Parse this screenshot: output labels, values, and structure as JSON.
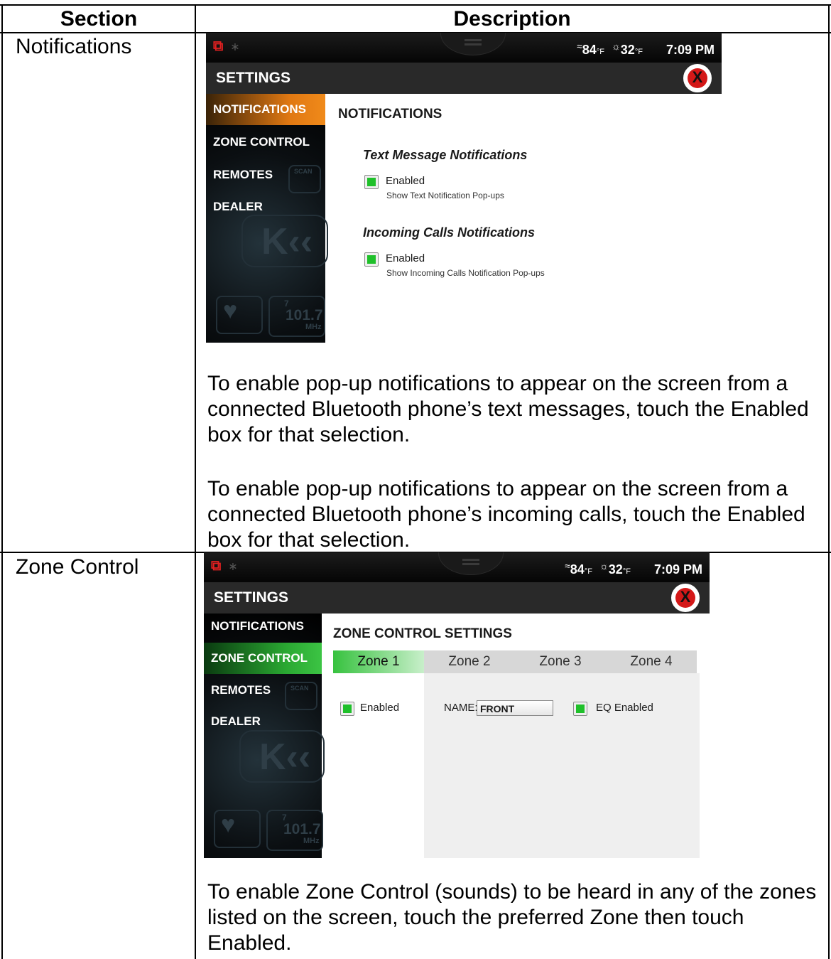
{
  "table": {
    "header_section": "Section",
    "header_description": "Description"
  },
  "rows": [
    {
      "section": "Notifications",
      "screen": {
        "status": {
          "temp1": "84",
          "temp2": "32",
          "unit": "°F",
          "time": "7:09 PM"
        },
        "title": "SETTINGS",
        "close_symbol": "X",
        "sidebar": [
          "NOTIFICATIONS",
          "ZONE CONTROL",
          "REMOTES",
          "DEALER"
        ],
        "ghost": {
          "scan": "SCAN",
          "freq": "101.7",
          "mhz": "MHz",
          "preset": "7"
        },
        "heading": "NOTIFICATIONS",
        "groups": [
          {
            "title": "Text Message Notifications",
            "checkbox": "Enabled",
            "help": "Show Text Notification Pop-ups"
          },
          {
            "title": "Incoming Calls Notifications",
            "checkbox": "Enabled",
            "help": "Show Incoming Calls Notification Pop-ups"
          }
        ]
      },
      "paragraphs": [
        "To enable pop-up notifications to appear on the screen from a connected Bluetooth phone’s text messages, touch the Enabled box for that selection.",
        "To enable pop-up notifications to appear on the screen from a connected Bluetooth phone’s incoming calls, touch the Enabled box for that selection."
      ]
    },
    {
      "section": "Zone Control",
      "screen": {
        "status": {
          "temp1": "84",
          "temp2": "32",
          "unit": "°F",
          "time": "7:09 PM"
        },
        "title": "SETTINGS",
        "close_symbol": "X",
        "sidebar": [
          "NOTIFICATIONS",
          "ZONE CONTROL",
          "REMOTES",
          "DEALER"
        ],
        "ghost": {
          "scan": "SCAN",
          "freq": "101.7",
          "mhz": "MHz",
          "preset": "7"
        },
        "heading": "ZONE CONTROL SETTINGS",
        "tabs": [
          "Zone 1",
          "Zone 2",
          "Zone 3",
          "Zone 4"
        ],
        "enabled_label": "Enabled",
        "name_label": "NAME:",
        "name_value": "FRONT",
        "eq_label": "EQ Enabled"
      },
      "paragraphs": [
        "To enable Zone Control (sounds) to be heard in any of the zones listed on the screen, touch the preferred Zone then touch Enabled."
      ]
    }
  ]
}
